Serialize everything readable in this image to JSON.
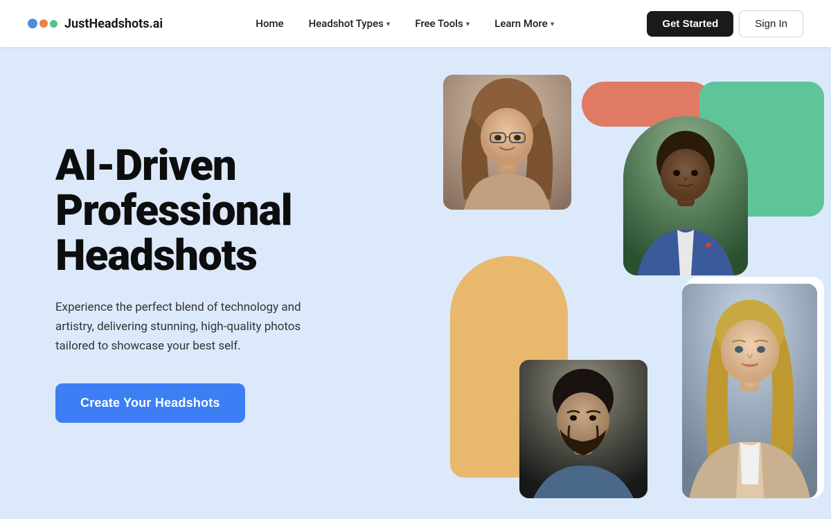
{
  "brand": {
    "name": "JustHeadshots.ai"
  },
  "nav": {
    "home": "Home",
    "headshot_types": "Headshot Types",
    "free_tools": "Free Tools",
    "learn_more": "Learn More",
    "get_started": "Get Started",
    "sign_in": "Sign In"
  },
  "hero": {
    "title_line1": "AI-Driven",
    "title_line2": "Professional",
    "title_line3": "Headshots",
    "subtitle": "Experience the perfect blend of technology and artistry, delivering stunning, high-quality photos tailored to showcase your best self.",
    "cta": "Create Your Headshots"
  },
  "colors": {
    "accent_blue": "#3d7ef5",
    "dark": "#1a1a1a",
    "salmon": "#E07A65",
    "green": "#5FC49A",
    "gold": "#E8B86D"
  }
}
